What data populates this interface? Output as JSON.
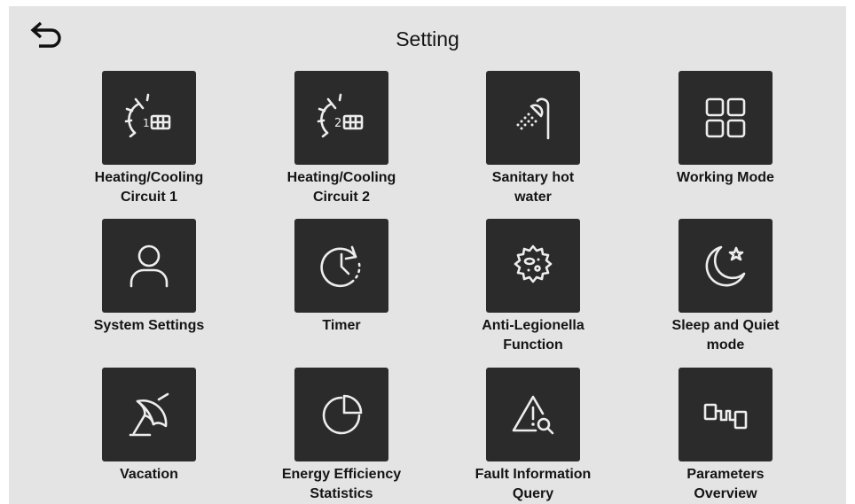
{
  "header": {
    "title": "Setting",
    "back_icon": "back-arrow-icon"
  },
  "tiles": [
    {
      "label": "Heating/Cooling\nCircuit 1",
      "icon": "heating-circuit-1-icon"
    },
    {
      "label": "Heating/Cooling\nCircuit 2",
      "icon": "heating-circuit-2-icon"
    },
    {
      "label": "Sanitary hot\nwater",
      "icon": "shower-icon"
    },
    {
      "label": "Working Mode",
      "icon": "grid-icon"
    },
    {
      "label": "System Settings",
      "icon": "user-icon"
    },
    {
      "label": "Timer",
      "icon": "clock-icon"
    },
    {
      "label": "Anti-Legionella\nFunction",
      "icon": "bacteria-icon"
    },
    {
      "label": "Sleep and Quiet\nmode",
      "icon": "moon-star-icon"
    },
    {
      "label": "Vacation",
      "icon": "umbrella-icon"
    },
    {
      "label": "Energy Efficiency\nStatistics",
      "icon": "pie-chart-icon"
    },
    {
      "label": "Fault Information\nQuery",
      "icon": "warning-search-icon"
    },
    {
      "label": "Parameters\nOverview",
      "icon": "parameters-icon"
    }
  ],
  "circuit_numbers": [
    "1",
    "2"
  ]
}
